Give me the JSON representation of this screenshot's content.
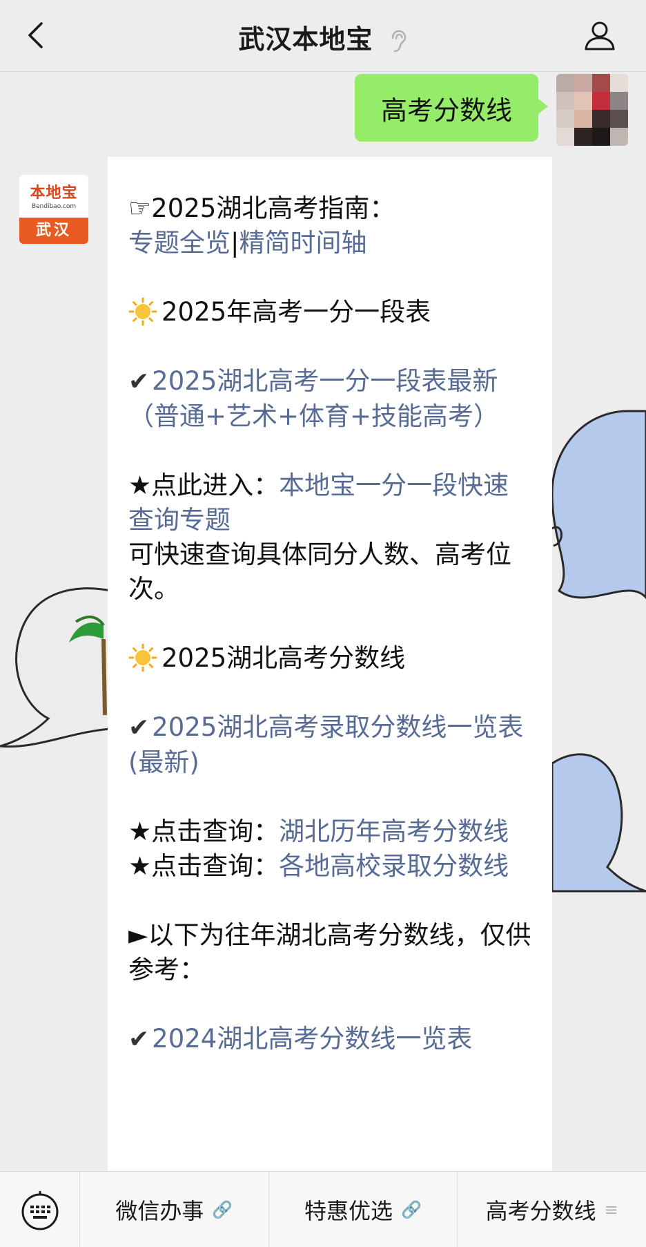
{
  "header": {
    "title": "武汉本地宝"
  },
  "user_message": {
    "text": "高考分数线"
  },
  "bot_avatar": {
    "brand": "本地宝",
    "domain": "Bendibao.com",
    "city": "武汉"
  },
  "message": {
    "guide_prefix": "☞2025湖北高考指南：",
    "guide_link_1": "专题全览",
    "guide_sep": "|",
    "guide_link_2": "精简时间轴",
    "section1_title": "2025年高考一分一段表",
    "section1_link": "2025湖北高考一分一段表最新（普通+艺术+体育+技能高考）",
    "entry_prefix": "★点此进入：",
    "entry_link": "本地宝一分一段快速查询专题",
    "entry_desc": "可快速查询具体同分人数、高考位次。",
    "section2_title": "2025湖北高考分数线",
    "section2_link": "2025湖北高考录取分数线一览表 (最新)",
    "query1_prefix": "★点击查询：",
    "query1_link": "湖北历年高考分数线",
    "query2_prefix": "★点击查询：",
    "query2_link": "各地高校录取分数线",
    "past_note": "►以下为往年湖北高考分数线，仅供参考：",
    "past_link": "2024湖北高考分数线一览表",
    "check": "✔"
  },
  "menu": {
    "items": [
      {
        "label": "微信办事",
        "icon": "link-icon"
      },
      {
        "label": "特惠优选",
        "icon": "link-icon"
      },
      {
        "label": "高考分数线",
        "icon": "list-icon"
      }
    ]
  },
  "colors": {
    "link": "#576b95",
    "bubble_green": "#95ec69",
    "brand_orange": "#e85a21"
  }
}
